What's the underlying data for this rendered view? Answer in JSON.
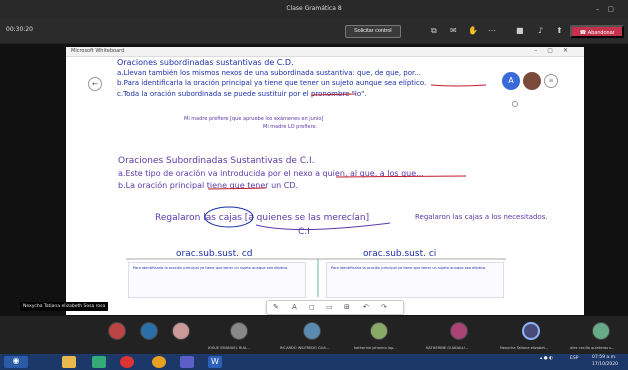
{
  "window": {
    "title": "Clase Gramática 8"
  },
  "meeting": {
    "timer": "00:30:20",
    "request_control": "Solicitar control",
    "leave": "Abandonar",
    "colors": {
      "leave": "#c4314b"
    }
  },
  "whiteboard": {
    "app_title": "Microsoft Whiteboard",
    "side_avatar_initial": "A",
    "lines": [
      "Oraciones subordinadas sustantivas de C.D.",
      "a.Llevan también los mismos nexos de una subordinada sustantiva: que, de que, por...",
      "b.Para identificarla la oración principal ya tiene que tener un sujeto aunque sea elíptico.",
      "c.Toda la oración subordinada se puede sustituir por el pronombre \"lo\".",
      "Mi madre prefiere [que apruebe los exámenes en junio]",
      "Mi madre LO prefiere.",
      "Oraciones Subordinadas Sustantivas de C.I.",
      "a.Este tipo de oración va introducida por el nexo a quien, al que, a los que...",
      "b.La oración principal tiene que tener un CD.",
      "Regalaron las cajas [a quienes se las merecían]",
      "Regalaron las cajas a los necesitados.",
      "C.I",
      "orac.sub.sust. cd",
      "orac.sub.sust. ci"
    ],
    "notes": [
      "Para identificarla la oración principal ya tiene que tener un sujeto aunque sea elíptico.",
      "Para identificarla la oración principal ya tiene que tener un sujeto aunque sea elíptico."
    ]
  },
  "presenter_tag": "Nexycha Tatiana elizabeth Sosa rosa",
  "participants": [
    "JOSUE EMANUEL RUA...",
    "RICARDO WILFREDO GUA...",
    "katherine johanna lop...",
    "KATHERINE GUADALU...",
    "Nexycha Tatiana elizabet...",
    "alex cecilia quinteros s..."
  ],
  "taskbar": {
    "lang": "ESP",
    "time": "07:59 a.m.",
    "date": "17/10/2020"
  }
}
